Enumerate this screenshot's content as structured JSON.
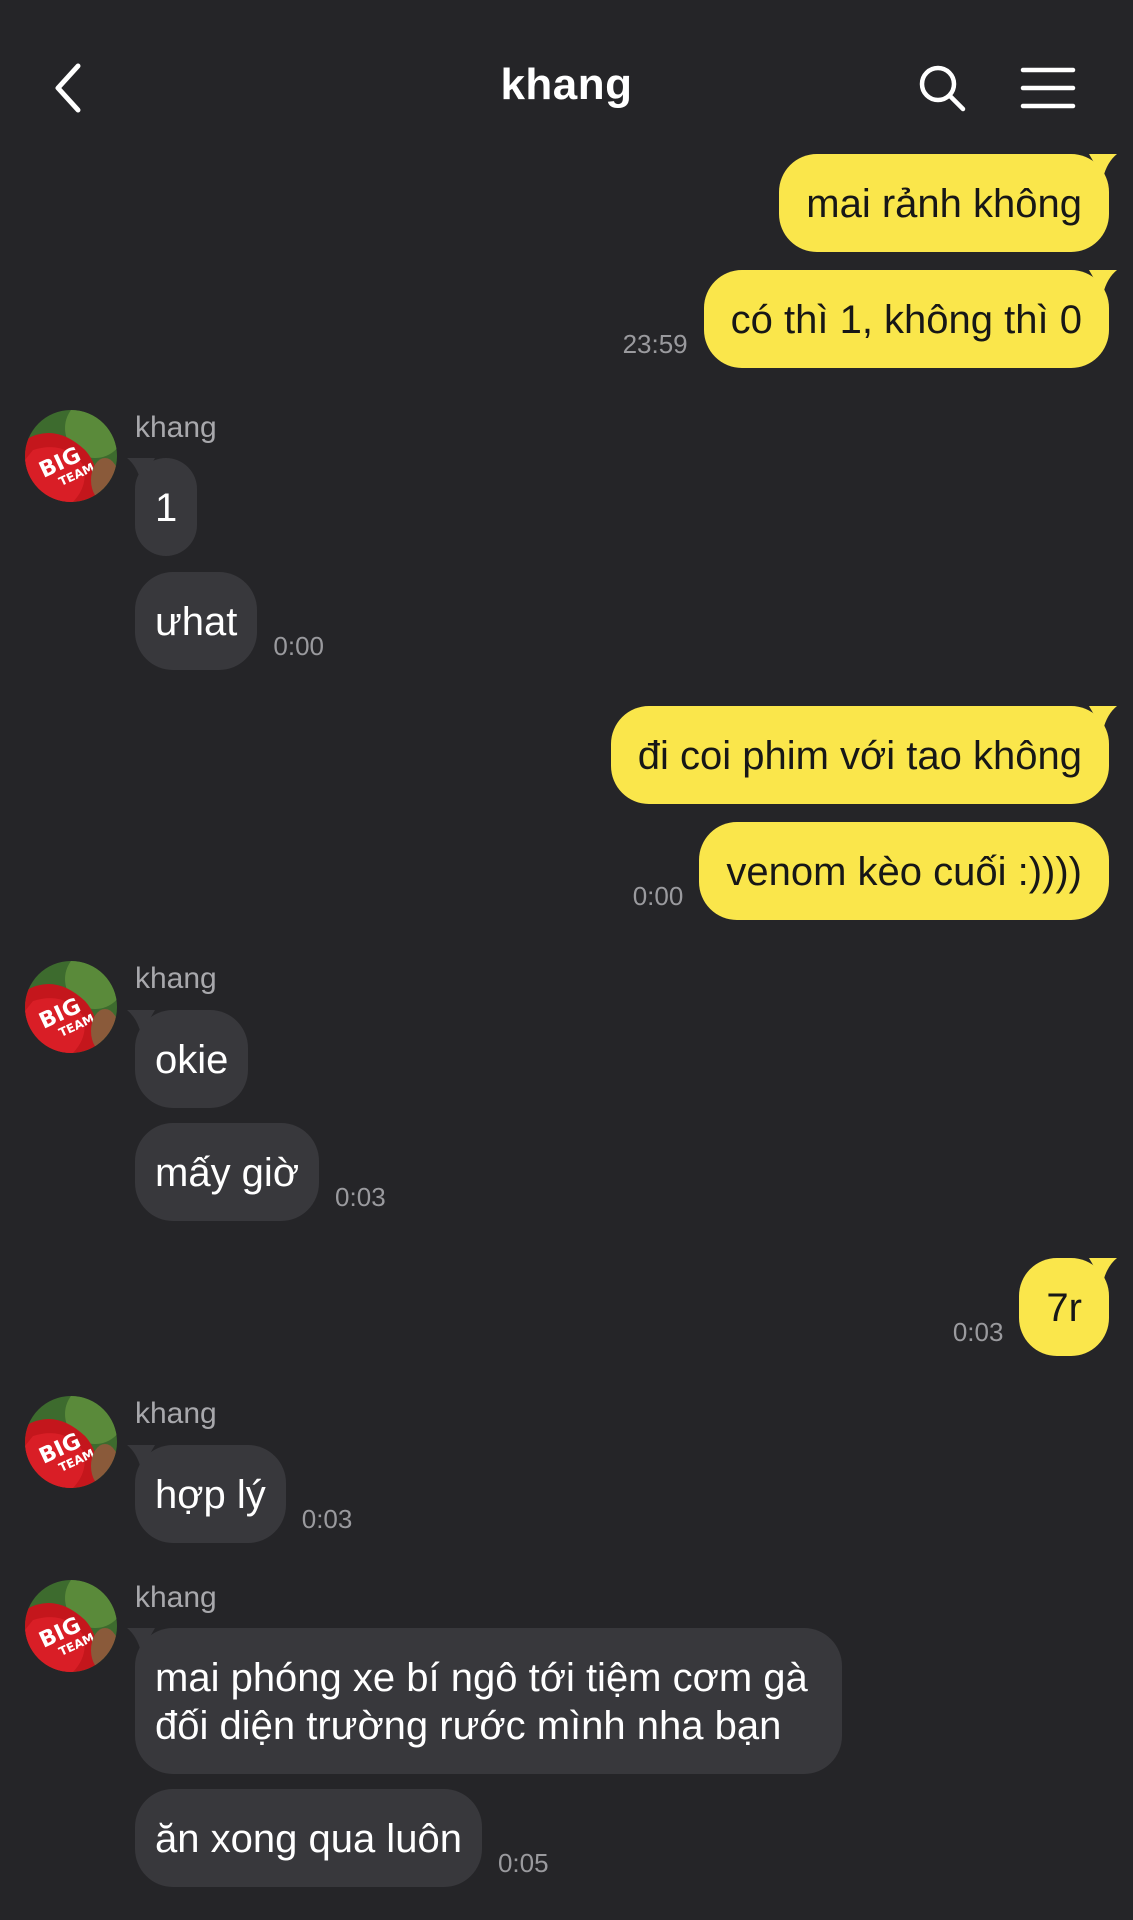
{
  "header": {
    "title": "khang",
    "back_icon": "chevron-left-icon",
    "search_icon": "search-icon",
    "menu_icon": "hamburger-menu-icon"
  },
  "colors": {
    "background": "#252528",
    "my_bubble": "#fae64b",
    "their_bubble": "#38383c",
    "timestamp": "#9a9a9e"
  },
  "messages": [
    {
      "from": "me",
      "text": "mai rảnh không"
    },
    {
      "from": "me",
      "text": "có thì 1, không thì 0",
      "time": "23:59"
    },
    {
      "from": "khang",
      "sender": "khang",
      "text": "1"
    },
    {
      "from": "khang",
      "text": "ưhat",
      "time": "0:00"
    },
    {
      "from": "me",
      "text": "đi coi phim với tao không"
    },
    {
      "from": "me",
      "text": "venom kèo cuối :))))",
      "time": "0:00"
    },
    {
      "from": "khang",
      "sender": "khang",
      "text": "okie"
    },
    {
      "from": "khang",
      "text": "mấy giờ",
      "time": "0:03"
    },
    {
      "from": "me",
      "text": "7r",
      "time": "0:03"
    },
    {
      "from": "khang",
      "sender": "khang",
      "text": "hợp lý",
      "time": "0:03"
    },
    {
      "from": "khang",
      "sender": "khang",
      "text": "mai phóng xe bí ngô tới tiệm cơm gà đối diện trường rước mình nha bạn"
    },
    {
      "from": "khang",
      "text": "ăn xong qua luôn",
      "time": "0:05"
    }
  ]
}
